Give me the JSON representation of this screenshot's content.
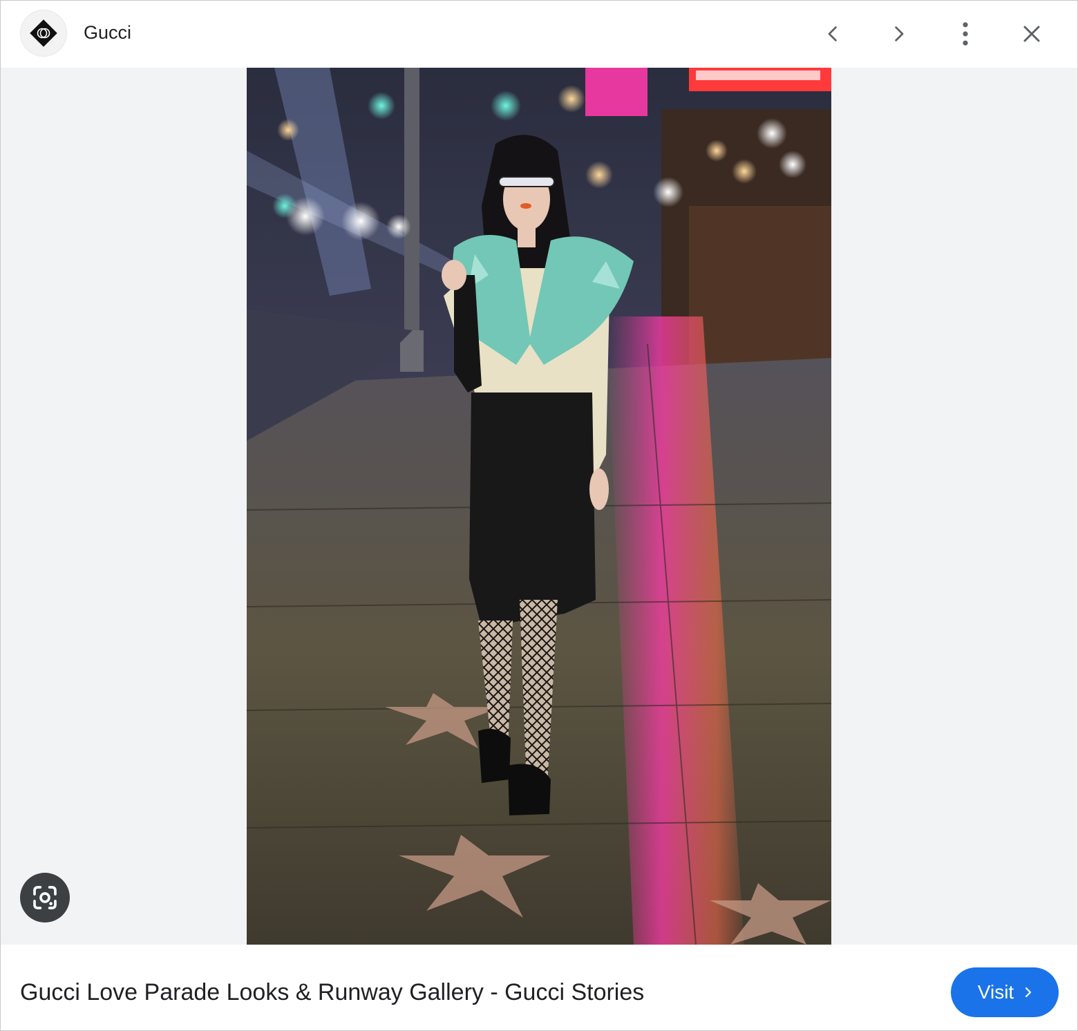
{
  "header": {
    "source_name": "Gucci",
    "prev_icon": "chevron-left-icon",
    "next_icon": "chevron-right-icon",
    "more_icon": "more-vert-icon",
    "close_icon": "close-icon"
  },
  "viewer": {
    "lens_icon": "google-lens-icon"
  },
  "footer": {
    "result_title": "Gucci Love Parade Looks & Runway Gallery - Gucci Stories",
    "visit_label": "Visit"
  },
  "colors": {
    "accent": "#1a73e8",
    "viewer_bg": "#f1f3f4",
    "icon": "#5f6368",
    "text": "#202124"
  }
}
